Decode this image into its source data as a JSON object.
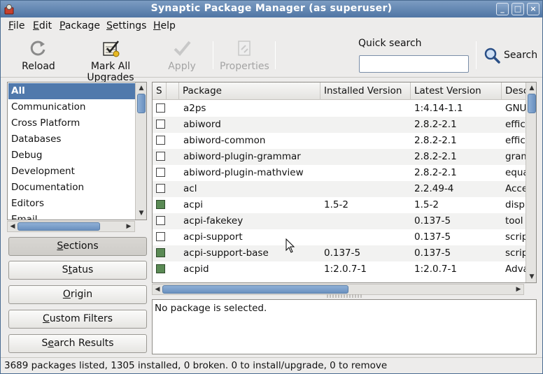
{
  "window": {
    "title": "Synaptic Package Manager  (as superuser)",
    "controls": [
      "_",
      "□",
      "×"
    ]
  },
  "menubar": {
    "items": [
      {
        "mnemonic": "F",
        "rest": "ile"
      },
      {
        "mnemonic": "E",
        "rest": "dit"
      },
      {
        "mnemonic": "P",
        "rest": "ackage"
      },
      {
        "mnemonic": "S",
        "rest": "ettings"
      },
      {
        "mnemonic": "H",
        "rest": "elp"
      }
    ]
  },
  "toolbar": {
    "reload": "Reload",
    "mark_all_upgrades": "Mark All Upgrades",
    "apply": "Apply",
    "properties": "Properties",
    "quick_search_label": "Quick search",
    "quick_search_value": "",
    "search": "Search"
  },
  "sections": {
    "items": [
      "All",
      "Communication",
      "Cross Platform",
      "Databases",
      "Debug",
      "Development",
      "Documentation",
      "Editors",
      "Email"
    ],
    "selected": "All"
  },
  "filter_buttons": {
    "sections": {
      "pre": "",
      "mnemonic": "S",
      "post": "ections"
    },
    "status": {
      "pre": "S",
      "mnemonic": "t",
      "post": "atus"
    },
    "origin": {
      "pre": "",
      "mnemonic": "O",
      "post": "rigin"
    },
    "custom_filters": {
      "pre": "",
      "mnemonic": "C",
      "post": "ustom Filters"
    },
    "search_results": {
      "pre": "S",
      "mnemonic": "e",
      "post": "arch Results"
    }
  },
  "table": {
    "columns": [
      "S",
      "Package",
      "Installed Version",
      "Latest Version",
      "Description"
    ],
    "rows": [
      {
        "installed": false,
        "package": "a2ps",
        "installed_version": "",
        "latest_version": "1:4.14-1.1",
        "description": "GNU"
      },
      {
        "installed": false,
        "package": "abiword",
        "installed_version": "",
        "latest_version": "2.8.2-2.1",
        "description": "effic"
      },
      {
        "installed": false,
        "package": "abiword-common",
        "installed_version": "",
        "latest_version": "2.8.2-2.1",
        "description": "effic"
      },
      {
        "installed": false,
        "package": "abiword-plugin-grammar",
        "installed_version": "",
        "latest_version": "2.8.2-2.1",
        "description": "gram"
      },
      {
        "installed": false,
        "package": "abiword-plugin-mathview",
        "installed_version": "",
        "latest_version": "2.8.2-2.1",
        "description": "equa"
      },
      {
        "installed": false,
        "package": "acl",
        "installed_version": "",
        "latest_version": "2.2.49-4",
        "description": "Acce"
      },
      {
        "installed": true,
        "package": "acpi",
        "installed_version": "1.5-2",
        "latest_version": "1.5-2",
        "description": "disp"
      },
      {
        "installed": false,
        "package": "acpi-fakekey",
        "installed_version": "",
        "latest_version": "0.137-5",
        "description": "tool"
      },
      {
        "installed": false,
        "package": "acpi-support",
        "installed_version": "",
        "latest_version": "0.137-5",
        "description": "scrip"
      },
      {
        "installed": true,
        "package": "acpi-support-base",
        "installed_version": "0.137-5",
        "latest_version": "0.137-5",
        "description": "scrip"
      },
      {
        "installed": true,
        "package": "acpid",
        "installed_version": "1:2.0.7-1",
        "latest_version": "1:2.0.7-1",
        "description": "Adva"
      }
    ]
  },
  "details": {
    "text": "No package is selected."
  },
  "statusbar": {
    "text": "3689 packages listed, 1305 installed, 0 broken. 0 to install/upgrade, 0 to remove"
  },
  "colors": {
    "titlebar": "#5a7fab",
    "selection": "#5079ac",
    "installed_check": "#5a8a54"
  }
}
